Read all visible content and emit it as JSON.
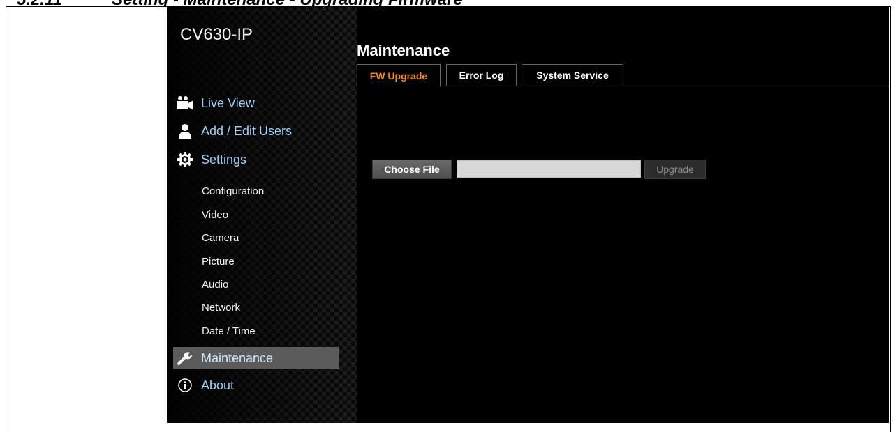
{
  "doc": {
    "section_number": "5.2.11",
    "section_title": "Setting - Maintenance - Upgrading Firmware"
  },
  "app": {
    "title": "CV630-IP"
  },
  "nav": {
    "main": [
      {
        "label": "Live View",
        "icon": "video-camera-icon"
      },
      {
        "label": "Add / Edit Users",
        "icon": "user-icon"
      },
      {
        "label": "Settings",
        "icon": "gear-icon"
      }
    ],
    "settings_sub": [
      "Configuration",
      "Video",
      "Camera",
      "Picture",
      "Audio",
      "Network",
      "Date / Time"
    ],
    "maintenance": {
      "label": "Maintenance",
      "icon": "wrench-icon",
      "active": true
    },
    "about": {
      "label": "About",
      "icon": "info-icon"
    }
  },
  "page": {
    "title": "Maintenance",
    "tabs": [
      {
        "label": "FW Upgrade",
        "active": true
      },
      {
        "label": "Error Log",
        "active": false
      },
      {
        "label": "System Service",
        "active": false
      }
    ],
    "choose_file_label": "Choose File",
    "file_value": "",
    "upgrade_label": "Upgrade"
  },
  "colors": {
    "accent": "#f08a1c",
    "nav_link": "#9dd0f5",
    "active_bg": "#5b5b5b"
  }
}
